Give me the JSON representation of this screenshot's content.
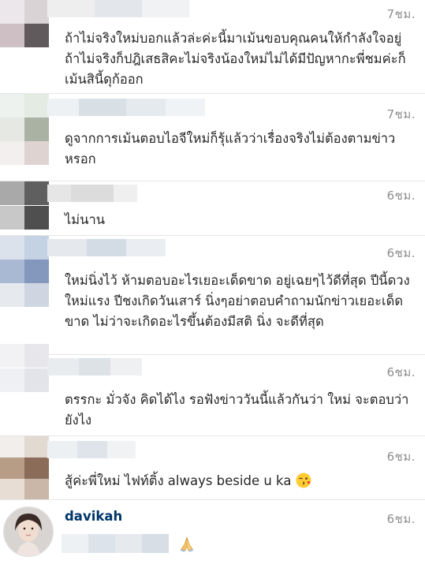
{
  "comments": [
    {
      "time": "7ชม.",
      "text": "ถ้าไม่จริงใหม่บอกแล้วล่ะค่ะนี้มาเม้นขอบคุณคนให้กำลังใจอยู่ถ้าไม่จริงก็ปฎิเสธสิคะไม่จริงน้องใหม่ไม่ได้มีปัญหากะพี่ชมค่ะก็เม้นสินี้ดุก้ออก"
    },
    {
      "time": "7ชม.",
      "text": "ดูจากการเม้นตอบไอจีใหม่ก็รุ้แล้วว่าเรื่องจริงไม่ต้องตามข่าวหรอก"
    },
    {
      "time": "6ชม.",
      "text": "ไม่นาน"
    },
    {
      "time": "6ชม.",
      "text": "ใหม่นิ่งไว้ ห้ามตอบอะไรเยอะเด็ดขาด อยู่เฉยๆไว้ดีที่สุด ปีนี้ดวงใหม่แรง ปีชงเกิดวันเสาร์ นิ่งๆอย่าตอบคำถามนักข่าวเยอะเด็ดขาด ไม่ว่าจะเกิดอะไรขึ้นต้องมีสติ นิ่ง จะดีที่สุด"
    },
    {
      "time": "6ชม.",
      "text": "ตรรกะ มั่วจัง  คิดได้ไง  รอฟังข่าววันนี้แล้วกันว่า ใหม่ จะตอบว่ายังไง"
    },
    {
      "time": "6ชม.",
      "text": "สู้ค่ะพี่ใหม่ ไฟท์ติ้ง always beside u ka",
      "emoji": "kissing-face-emoji"
    }
  ],
  "author_reply": {
    "username": "davikah",
    "time": "6ชม.",
    "emoji": "folded-hands-emoji"
  }
}
